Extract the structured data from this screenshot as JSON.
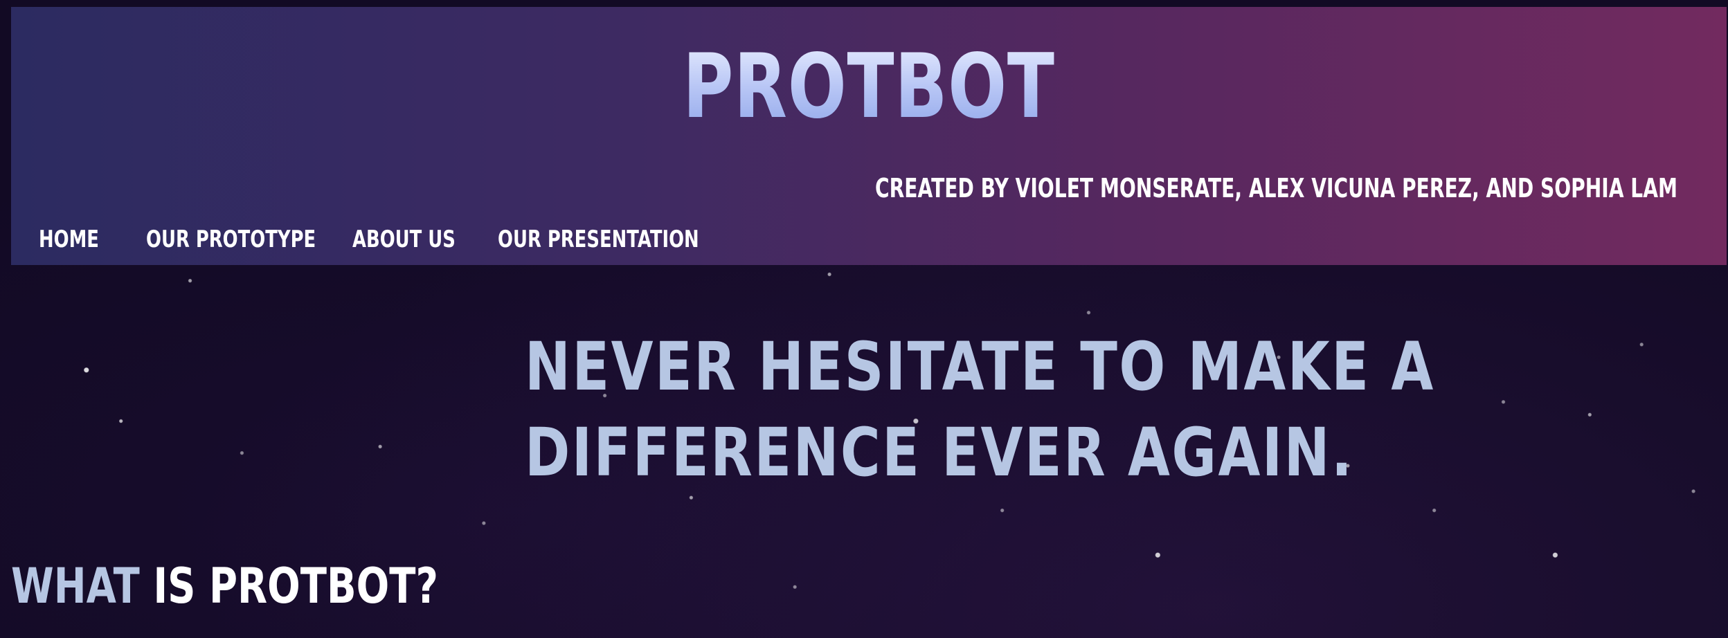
{
  "header": {
    "title": "PROTBOT",
    "credits": "CREATED BY VIOLET MONSERATE, ALEX VICUNA PEREZ, AND SOPHIA LAM",
    "gradient_colors": [
      "#2c2b61",
      "#722a5f"
    ]
  },
  "nav": {
    "items": [
      {
        "label": "HOME"
      },
      {
        "label": "OUR PROTOTYPE"
      },
      {
        "label": "ABOUT US"
      },
      {
        "label": "OUR PRESENTATION"
      }
    ]
  },
  "hero": {
    "tagline": "NEVER HESITATE TO MAKE A DIFFERENCE EVER AGAIN."
  },
  "section": {
    "heading_accent": "WHAT",
    "heading_main": "IS PROTBOT?"
  },
  "colors": {
    "background": "#120a24",
    "accent_text": "#b6c6e3",
    "title_gradient_top": "#e8edff",
    "title_gradient_bottom": "#8fa6ea"
  }
}
